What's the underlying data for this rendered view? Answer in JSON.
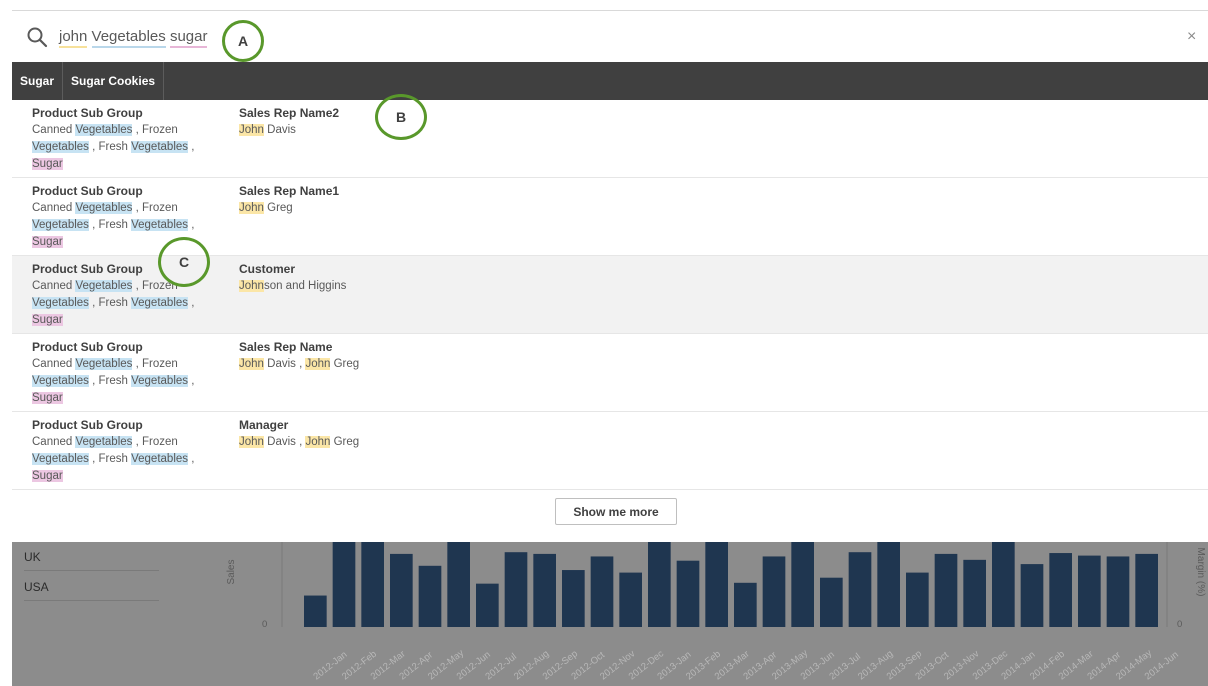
{
  "search": {
    "terms": [
      "john",
      "Vegetables",
      "sugar"
    ],
    "close_label": "×"
  },
  "markers": {
    "a": "A",
    "b": "B",
    "c": "C"
  },
  "tabs": [
    "Sugar",
    "Sugar Cookies"
  ],
  "results": [
    {
      "field1": "Product Sub Group",
      "field2": "Sales Rep Name2",
      "v2": [
        [
          "John",
          " Davis"
        ]
      ]
    },
    {
      "field1": "Product Sub Group",
      "field2": "Sales Rep Name1",
      "v2": [
        [
          "John",
          " Greg"
        ]
      ]
    },
    {
      "field1": "Product Sub Group",
      "field2": "Customer",
      "v2": [
        [
          "John",
          "son and Higgins"
        ]
      ]
    },
    {
      "field1": "Product Sub Group",
      "field2": "Sales Rep Name",
      "v2": [
        [
          "John",
          " Davis"
        ],
        [
          "John",
          " Greg"
        ]
      ]
    },
    {
      "field1": "Product Sub Group",
      "field2": "Manager",
      "v2": [
        [
          "John",
          " Davis"
        ],
        [
          "John",
          " Greg"
        ]
      ]
    }
  ],
  "field1_values": {
    "prefix1": "Canned ",
    "hl1": "Vegetables",
    "mid1": " , Frozen",
    "hl2": "Vegetables",
    "mid2": " , Fresh ",
    "hl3": "Vegetables",
    "mid3": " ,",
    "hl4": "Sugar"
  },
  "show_more_label": "Show me more",
  "background": {
    "countries": [
      "UK",
      "USA"
    ],
    "y_label_left": "Sales",
    "y_label_right": "Margin (%)",
    "zero_left": "0",
    "zero_right": "0",
    "months": [
      "2012-Jan",
      "2012-Feb",
      "2012-Mar",
      "2012-Apr",
      "2012-May",
      "2012-Jun",
      "2012-Jul",
      "2012-Aug",
      "2012-Sep",
      "2012-Oct",
      "2012-Nov",
      "2012-Dec",
      "2013-Jan",
      "2013-Feb",
      "2013-Mar",
      "2013-Apr",
      "2013-May",
      "2013-Jun",
      "2013-Jul",
      "2013-Aug",
      "2013-Sep",
      "2013-Oct",
      "2013-Nov",
      "2013-Dec",
      "2014-Jan",
      "2014-Feb",
      "2014-Mar",
      "2014-Apr",
      "2014-May",
      "2014-Jun"
    ],
    "bar_levels": [
      0.37,
      1.0,
      1.0,
      0.86,
      0.72,
      1.0,
      0.51,
      0.88,
      0.86,
      0.67,
      0.83,
      0.64,
      1.0,
      0.78,
      1.0,
      0.52,
      0.83,
      1.0,
      0.58,
      0.88,
      1.0,
      0.64,
      0.86,
      0.79,
      1.0,
      0.74,
      0.87,
      0.84,
      0.83,
      0.86
    ],
    "bar_color": "#1f3650"
  }
}
